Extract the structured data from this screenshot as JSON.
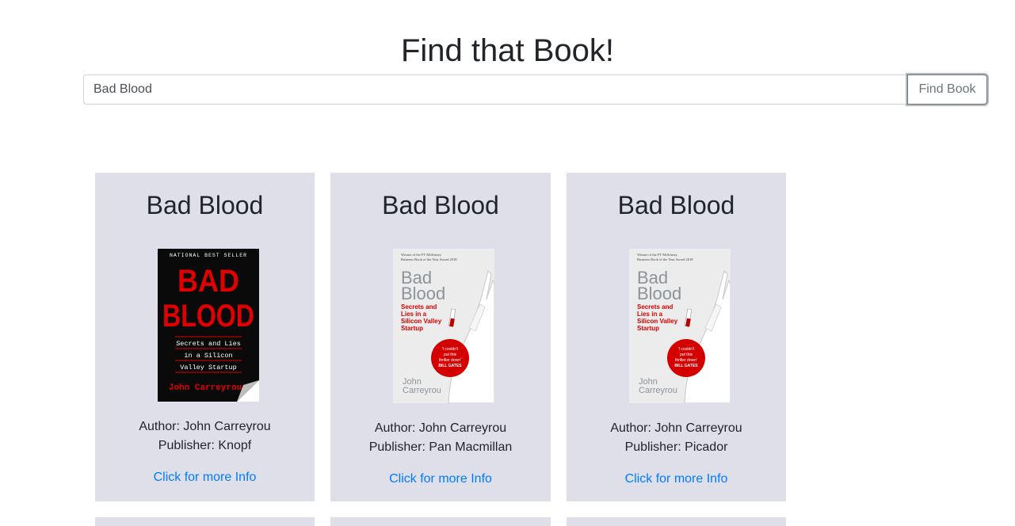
{
  "header": {
    "title": "Find that Book!"
  },
  "search": {
    "value": "Bad Blood",
    "button_label": "Find Book"
  },
  "results": [
    {
      "title": "Bad Blood",
      "author": "Author: John Carreyrou",
      "publisher": "Publisher: Knopf",
      "link_label": "Click for more Info",
      "cover": {
        "top_line": "NATIONAL BEST SELLER",
        "title_line1": "BAD",
        "title_line2": "BLOOD",
        "subtitle1": "Secrets and Lies",
        "subtitle2": "in a Silicon",
        "subtitle3": "Valley Startup",
        "author": "John Carreyrou"
      }
    },
    {
      "title": "Bad Blood",
      "author": "Author: John Carreyrou",
      "publisher": "Publisher: Pan Macmillan",
      "link_label": "Click for more Info",
      "cover": {
        "award1": "Winner of the FT McKinsey",
        "award2": "Business Book of the Year Award 2018",
        "title_line1": "Bad",
        "title_line2": "Blood",
        "subtitle1": "Secrets and",
        "subtitle2": "Lies in a",
        "subtitle3": "Silicon Valley",
        "subtitle4": "Startup",
        "quote1": "'I couldn't",
        "quote2": "put this",
        "quote3": "thriller down'",
        "quote4": "BILL GATES",
        "author1": "John",
        "author2": "Carreyrou"
      }
    },
    {
      "title": "Bad Blood",
      "author": "Author: John Carreyrou",
      "publisher": "Publisher: Picador",
      "link_label": "Click for more Info",
      "cover": {
        "award1": "Winner of the FT McKinsey",
        "award2": "Business Book of the Year Award 2018",
        "title_line1": "Bad",
        "title_line2": "Blood",
        "subtitle1": "Secrets and",
        "subtitle2": "Lies in a",
        "subtitle3": "Silicon Valley",
        "subtitle4": "Startup",
        "quote1": "'I couldn't",
        "quote2": "put this",
        "quote3": "thriller down'",
        "quote4": "BILL GATES",
        "author1": "John",
        "author2": "Carreyrou"
      }
    }
  ],
  "colors": {
    "card_bg": "#dfdfe9",
    "link": "#007bff",
    "cover_red": "#e00000",
    "cover_black": "#0a0a0a"
  }
}
